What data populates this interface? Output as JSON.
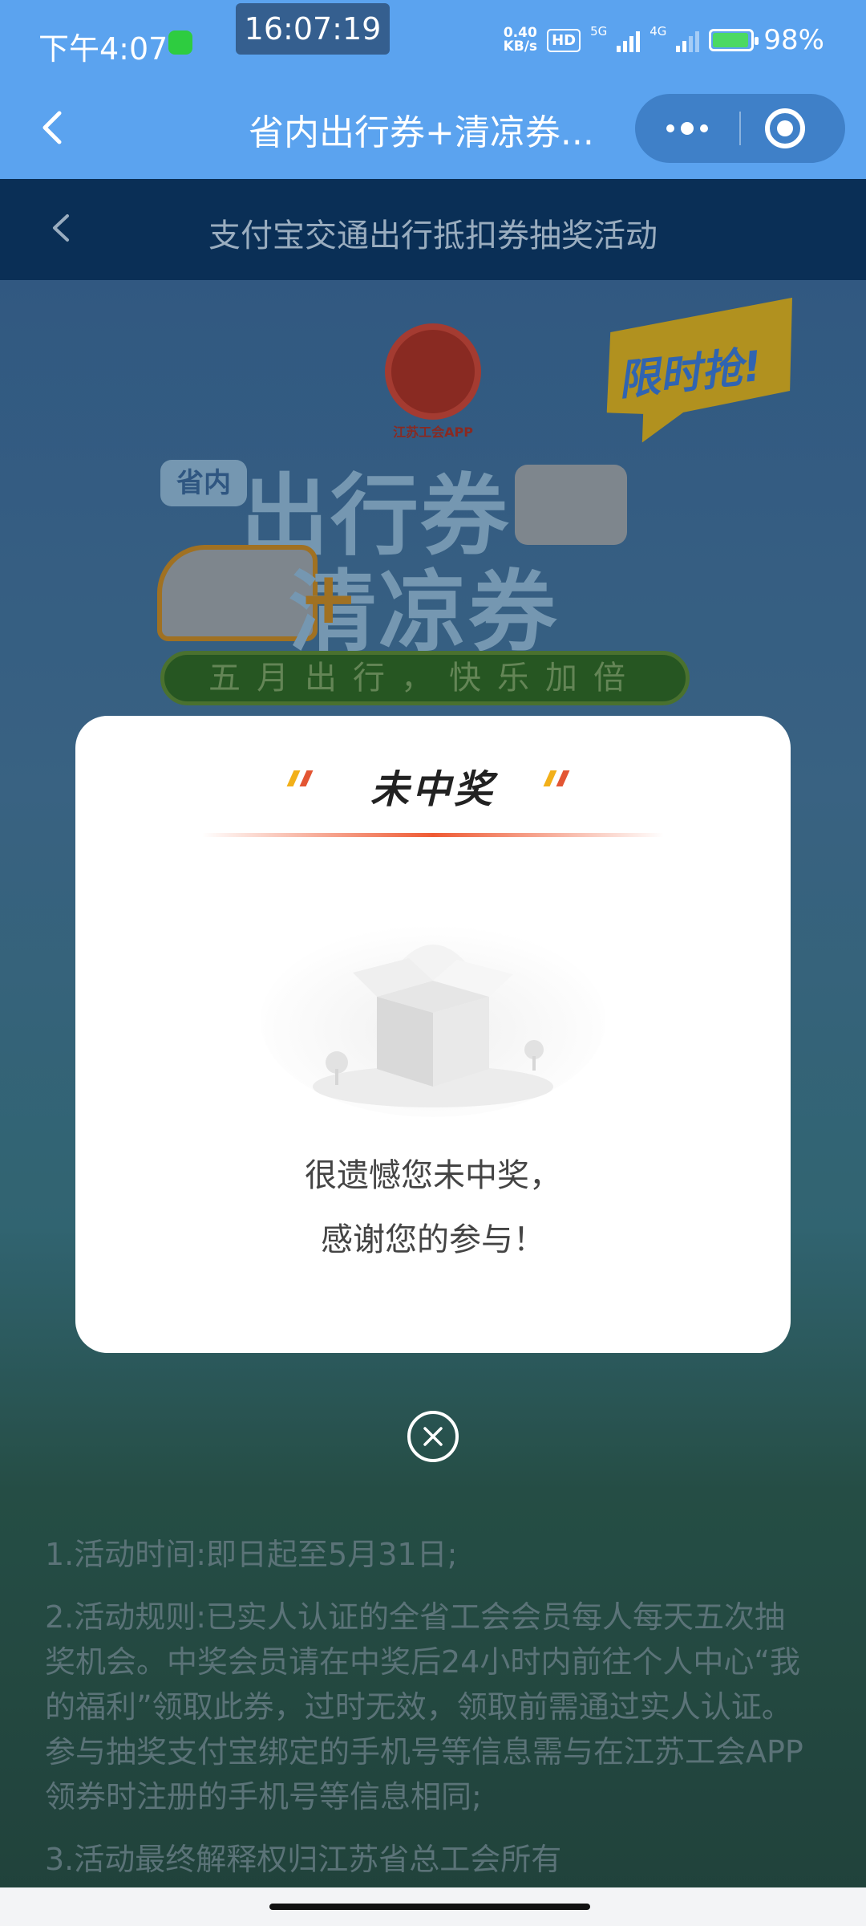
{
  "status_bar": {
    "time": "下午4:07",
    "clock": "16:07:19",
    "net_speed_value": "0.40",
    "net_speed_unit": "KB/s",
    "hd": "HD",
    "signal_1": "5G",
    "signal_2": "4G",
    "battery": "98%"
  },
  "app_bar": {
    "title": "省内出行券+清凉券..."
  },
  "page": {
    "subtitle": "支付宝交通出行抵扣券抽奖活动",
    "emblem_label": "江苏工会APP",
    "burst_text": "限时抢!",
    "province_tag": "省内",
    "headline_1": "出行券",
    "headline_plus": "+",
    "headline_2": "清凉券",
    "slogan": "五月出行，快乐加倍",
    "rules": [
      "1.活动时间:即日起至5月31日;",
      "2.活动规则:已实人认证的全省工会会员每人每天五次抽奖机会。中奖会员请在中奖后24小时内前往个人中心“我的福利”领取此券，过时无效，领取前需通过实人认证。参与抽奖支付宝绑定的手机号等信息需与在江苏工会APP领券时注册的手机号等信息相同;",
      "3.活动最终解释权归江苏省总工会所有"
    ]
  },
  "modal": {
    "title": "未中奖",
    "message_line1": "很遗憾您未中奖，",
    "message_line2": "感谢您的参与！"
  },
  "colors": {
    "header_blue": "#5ba3ef",
    "subbar_navy": "#0d3a6a",
    "accent_red": "#ef5a33",
    "accent_yellow": "#f2b019"
  }
}
